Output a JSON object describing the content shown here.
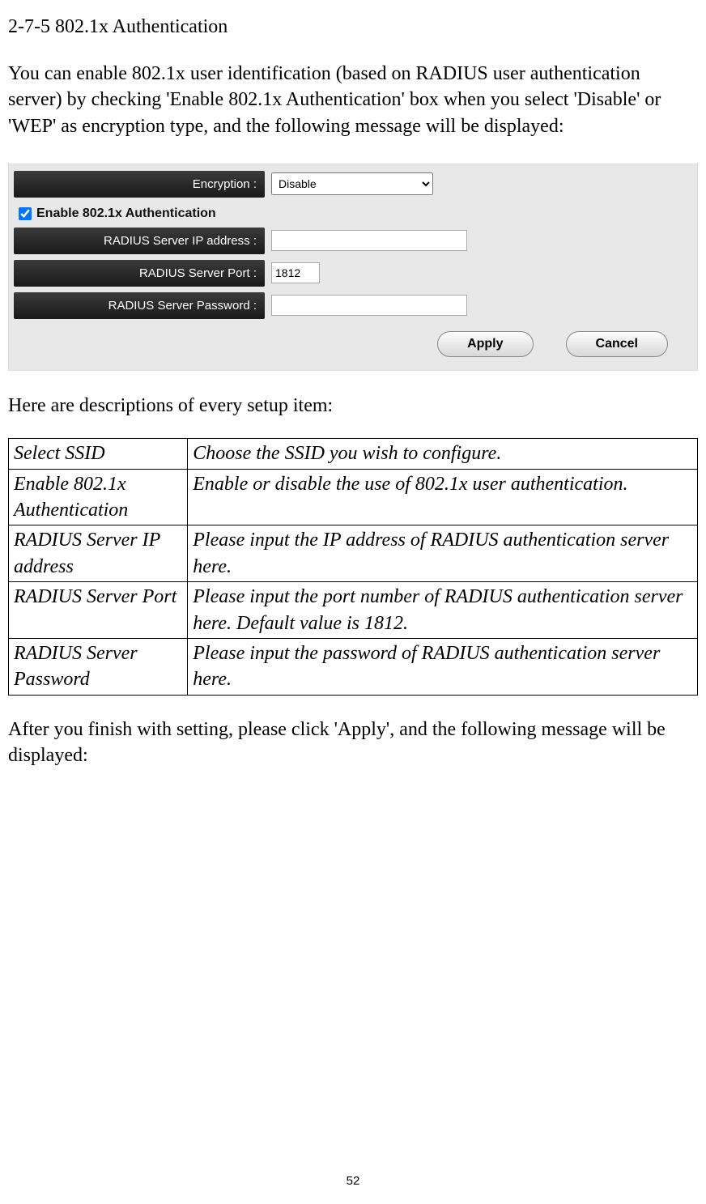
{
  "title": "2-7-5 802.1x Authentication",
  "intro": "You can enable 802.1x user identification (based on RADIUS user authentication server) by checking 'Enable 802.1x Authentication' box when you select 'Disable' or 'WEP' as encryption type, and the following message will be displayed:",
  "panel": {
    "encryption_label": "Encryption :",
    "encryption_value": "Disable",
    "enable_8021x_label": "Enable 802.1x Authentication",
    "enable_8021x_checked": true,
    "radius_ip_label": "RADIUS Server IP address :",
    "radius_ip_value": "",
    "radius_port_label": "RADIUS Server Port :",
    "radius_port_value": "1812",
    "radius_pw_label": "RADIUS Server Password :",
    "radius_pw_value": "",
    "apply_label": "Apply",
    "cancel_label": "Cancel"
  },
  "desc_heading": "Here are descriptions of every setup item:",
  "table": {
    "rows": [
      {
        "name": "Select SSID",
        "desc": "Choose the SSID you wish to configure."
      },
      {
        "name": "Enable 802.1x Authentication",
        "desc": "Enable or disable the use of 802.1x user authentication."
      },
      {
        "name": "RADIUS Server IP address",
        "desc": "Please input the IP address of RADIUS authentication server here."
      },
      {
        "name": "RADIUS Server Port",
        "desc": "Please input the port number of RADIUS authentication server here. Default value is 1812."
      },
      {
        "name": "RADIUS Server Password",
        "desc": "Please input the password of RADIUS authentication server here."
      }
    ]
  },
  "closing": "After you finish with setting, please click 'Apply', and the following message will be displayed:",
  "page_number": "52"
}
